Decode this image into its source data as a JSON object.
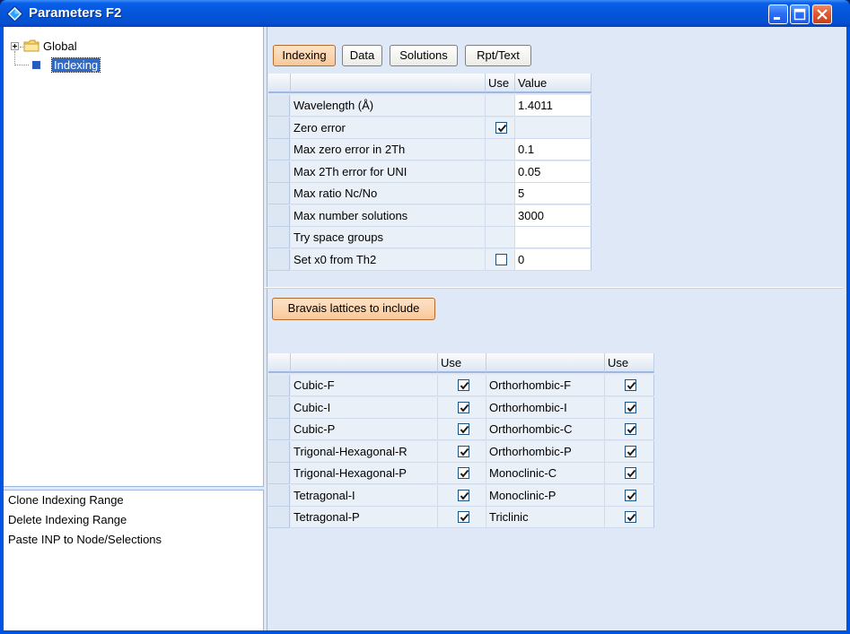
{
  "window": {
    "title": "Parameters F2"
  },
  "tree": {
    "items": [
      {
        "label": "Global"
      },
      {
        "label": "Indexing"
      }
    ]
  },
  "actions": [
    {
      "label": "Clone Indexing Range"
    },
    {
      "label": "Delete Indexing Range"
    },
    {
      "label": "Paste INP to Node/Selections"
    }
  ],
  "tabs": [
    {
      "label": "Indexing"
    },
    {
      "label": "Data"
    },
    {
      "label": "Solutions"
    },
    {
      "label": "Rpt/Text"
    }
  ],
  "params": {
    "header_use": "Use",
    "header_value": "Value",
    "rows": [
      {
        "label": "Wavelength (Å)",
        "value": "1.4011"
      },
      {
        "label": "Zero error",
        "value": ""
      },
      {
        "label": "Max zero error in 2Th",
        "value": "0.1"
      },
      {
        "label": "Max 2Th error for UNI",
        "value": "0.05"
      },
      {
        "label": "Max ratio Nc/No",
        "value": "5"
      },
      {
        "label": "Max number solutions",
        "value": "3000"
      },
      {
        "label": "Try space groups",
        "value": ""
      },
      {
        "label": "Set x0 from Th2",
        "value": "0"
      }
    ]
  },
  "bravais": {
    "button_label": "Bravais lattices to include",
    "header_use": "Use",
    "left": [
      {
        "label": "Cubic-F",
        "checked": true
      },
      {
        "label": "Cubic-I",
        "checked": true
      },
      {
        "label": "Cubic-P",
        "checked": true
      },
      {
        "label": "Trigonal-Hexagonal-R",
        "checked": true
      },
      {
        "label": "Trigonal-Hexagonal-P",
        "checked": true
      },
      {
        "label": "Tetragonal-I",
        "checked": true
      },
      {
        "label": "Tetragonal-P",
        "checked": true
      }
    ],
    "right": [
      {
        "label": "Orthorhombic-F",
        "checked": true
      },
      {
        "label": "Orthorhombic-I",
        "checked": true
      },
      {
        "label": "Orthorhombic-C",
        "checked": true
      },
      {
        "label": "Orthorhombic-P",
        "checked": true
      },
      {
        "label": "Monoclinic-C",
        "checked": true
      },
      {
        "label": "Monoclinic-P",
        "checked": true
      },
      {
        "label": "Triclinic",
        "checked": true
      }
    ]
  },
  "colors": {
    "title_bar": "#0455d9",
    "selected": "#316ac5",
    "active_tab": "#f8c89a",
    "pane_bg": "#dfe8f6"
  }
}
